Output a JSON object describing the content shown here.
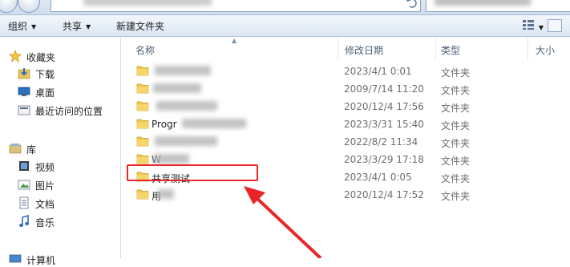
{
  "toolbar": {
    "organize_label": "组织",
    "share_label": "共享",
    "new_folder_label": "新建文件夹"
  },
  "navpane": {
    "favorites_label": "收藏夹",
    "favorites": [
      {
        "label": "下载",
        "icon": "download-folder-icon"
      },
      {
        "label": "桌面",
        "icon": "desktop-icon"
      },
      {
        "label": "最近访问的位置",
        "icon": "recent-places-icon"
      }
    ],
    "libraries_label": "库",
    "libraries": [
      {
        "label": "视频",
        "icon": "video-library-icon"
      },
      {
        "label": "图片",
        "icon": "pictures-library-icon"
      },
      {
        "label": "文档",
        "icon": "documents-library-icon"
      },
      {
        "label": "音乐",
        "icon": "music-library-icon"
      }
    ],
    "computer_label": "计算机"
  },
  "columns": {
    "name": "名称",
    "date": "修改日期",
    "type": "类型",
    "size": "大小"
  },
  "rows": [
    {
      "name": "",
      "date": "2023/4/1 0:01",
      "type": "文件夹"
    },
    {
      "name": "",
      "date": "2009/7/14 11:20",
      "type": "文件夹"
    },
    {
      "name": "",
      "date": "2020/12/4 17:56",
      "type": "文件夹"
    },
    {
      "name": "Progr",
      "date": "2023/3/31 15:40",
      "type": "文件夹"
    },
    {
      "name": "",
      "date": "2022/8/2 11:34",
      "type": "文件夹"
    },
    {
      "name": "W",
      "date": "2023/3/29 17:18",
      "type": "文件夹"
    },
    {
      "name": "共享测试",
      "date": "2023/4/1 0:05",
      "type": "文件夹"
    },
    {
      "name": "用",
      "date": "2020/12/4 17:52",
      "type": "文件夹"
    }
  ],
  "colors": {
    "annotation": "#e8262a",
    "folder": "#f0c94a"
  }
}
